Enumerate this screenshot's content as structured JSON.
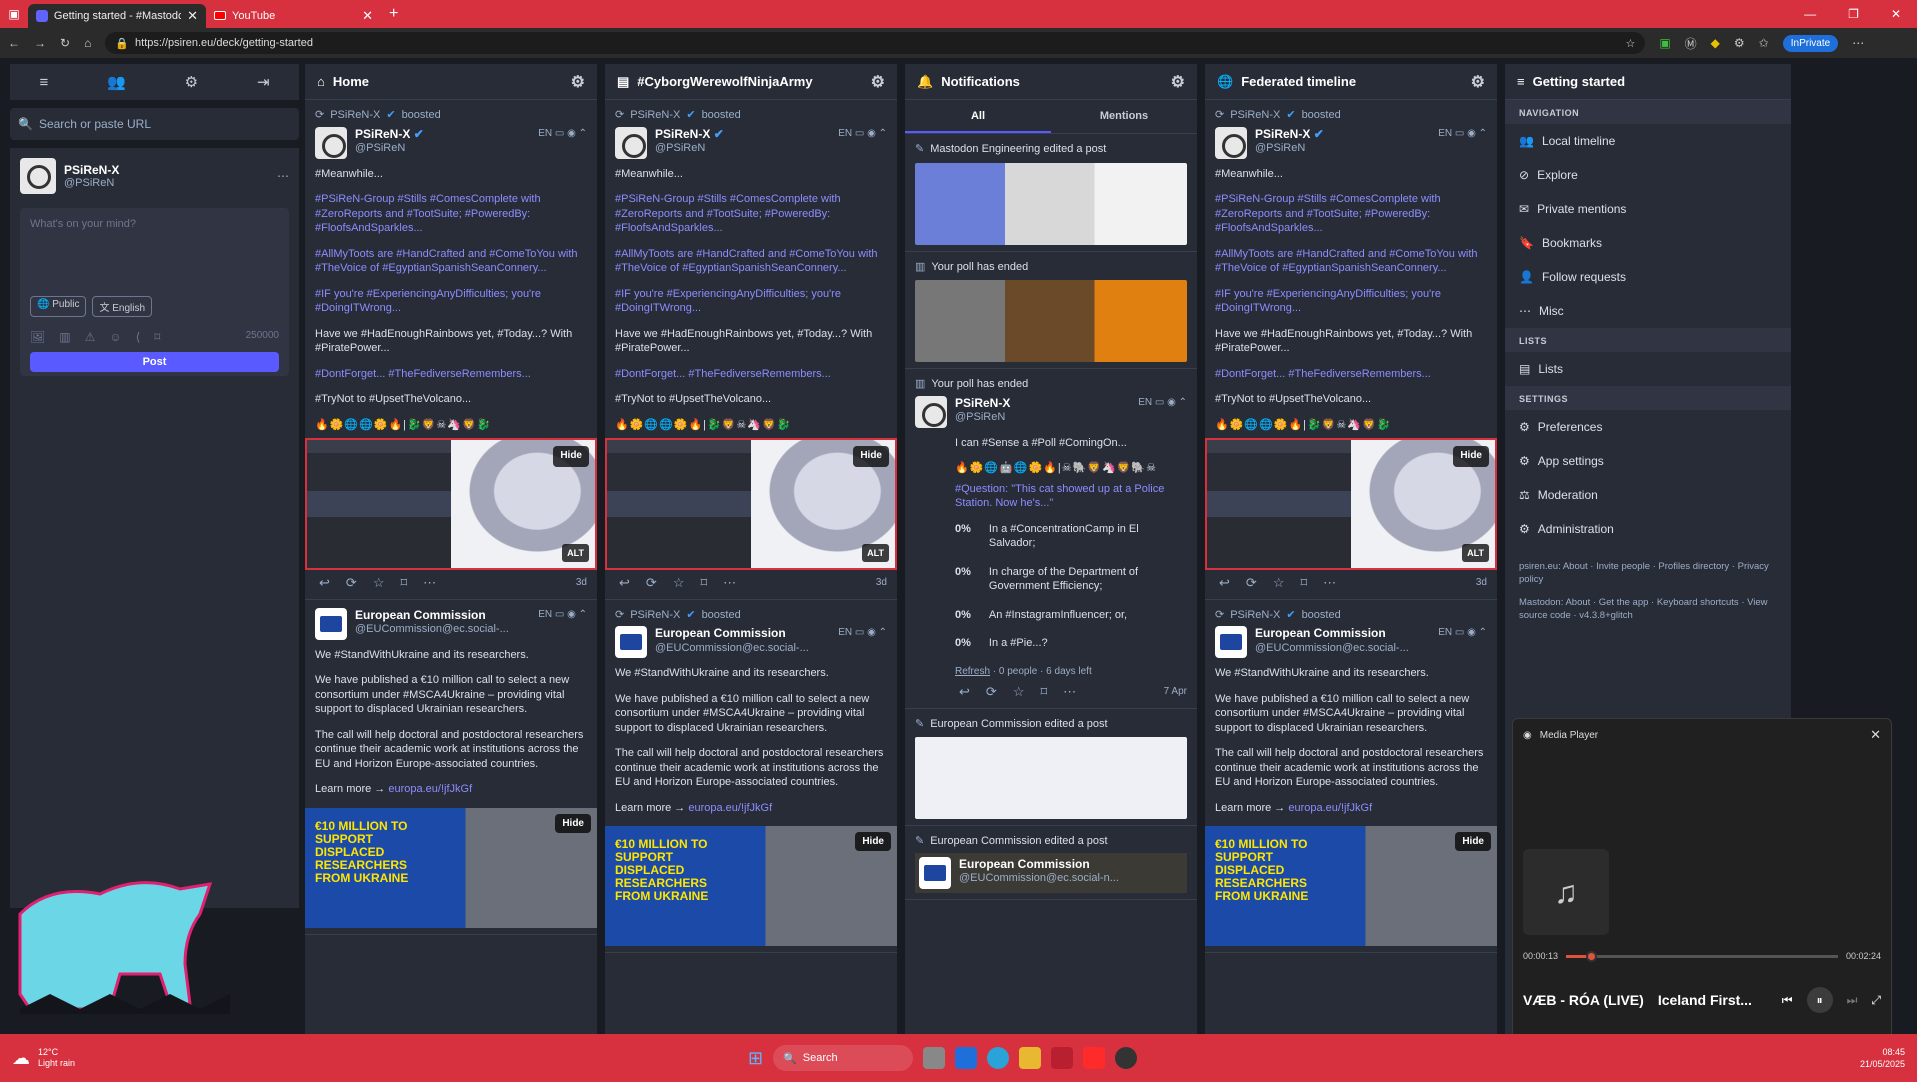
{
  "browser": {
    "tabs": [
      {
        "label": "Getting started - #MastodonSpyG",
        "active": true
      },
      {
        "label": "YouTube",
        "active": false
      }
    ],
    "url": "https://psiren.eu/deck/getting-started",
    "inprivate_label": "InPrivate"
  },
  "compose": {
    "search_placeholder": "Search or paste URL",
    "profile_name": "PSiReN-X",
    "profile_acct": "@PSiReN",
    "textarea_placeholder": "What's on your mind?",
    "visibility": "Public",
    "language": "English",
    "char_count": "250000",
    "post_label": "Post"
  },
  "columns": {
    "home": {
      "title": "Home"
    },
    "hashtag": {
      "title": "#CyborgWerewolfNinjaArmy"
    },
    "notifications": {
      "title": "Notifications",
      "tab_all": "All",
      "tab_mentions": "Mentions"
    },
    "federated": {
      "title": "Federated timeline"
    },
    "getting_started": {
      "title": "Getting started"
    }
  },
  "post1": {
    "prepend_name": "PSiReN-X",
    "prepend_action": "boosted",
    "name": "PSiReN-X",
    "acct": "@PSiReN",
    "lang": "EN",
    "para1": "#Meanwhile...",
    "para2": "#PSiReN-Group #Stills #ComesComplete with #ZeroReports and #TootSuite; #PoweredBy: #FloofsAndSparkles...",
    "para3": "#AllMyToots are #HandCrafted and #ComeToYou with #TheVoice of #EgyptianSpanishSeanConnery...",
    "para4": "#IF you're #ExperiencingAnyDifficulties; you're #DoingITWrong...",
    "para5": "Have we #HadEnoughRainbows yet, #Today...? With #PiratePower...",
    "para6": "#DontForget... #TheFediverseRemembers...",
    "para7": "#TryNot to #UpsetTheVolcano...",
    "emojis": "🔥🌼🌐🌐🌼🔥|🐉🦁☠🦄🦁🐉",
    "hide": "Hide",
    "alt": "ALT",
    "time": "3d"
  },
  "post2": {
    "name": "European Commission",
    "acct": "@EUCommission@ec.social-...",
    "lang": "EN",
    "para1": "We #StandWithUkraine and its researchers.",
    "para2": "We have published a €10 million call to select a new consortium under #MSCA4Ukraine – providing vital support to displaced Ukrainian researchers.",
    "para3": "The call will help doctoral and postdoctoral researchers continue their academic work at institutions across the EU and Horizon Europe-associated countries.",
    "learn_more": "Learn more →",
    "link": "europa.eu/!jfJkGf",
    "banner_text": "€10 MILLION TO SUPPORT DISPLACED RESEARCHERS FROM UKRAINE",
    "hide": "Hide"
  },
  "notifications": {
    "n1": "Mastodon Engineering edited a post",
    "n2": "Your poll has ended",
    "n3": "Your poll has ended",
    "poll_name": "PSiReN-X",
    "poll_acct": "@PSiReN",
    "poll_intro": "I can #Sense a #Poll #ComingOn...",
    "poll_emojis": "🔥🌼🌐🤖🌐🌼🔥|☠🐘🦁🦄🦁🐘☠",
    "poll_question": "#Question: \"This cat showed up at a Police Station. Now he's...\"",
    "options": [
      {
        "pct": "0%",
        "text": "In a #ConcentrationCamp in El Salvador;"
      },
      {
        "pct": "0%",
        "text": "In charge of the Department of Government Efficiency;"
      },
      {
        "pct": "0%",
        "text": "An #InstagramInfluencer; or,"
      },
      {
        "pct": "0%",
        "text": "In a #Pie...?"
      }
    ],
    "poll_footer_refresh": "Refresh",
    "poll_footer_rest": "· 0 people · 6 days left",
    "poll_time": "7 Apr",
    "n4": "European Commission edited a post",
    "n5": "European Commission edited a post",
    "n5_name": "European Commission",
    "n5_acct": "@EUCommission@ec.social-n..."
  },
  "getting_started": {
    "nav_heading": "NAVIGATION",
    "nav": [
      "Local timeline",
      "Explore",
      "Private mentions",
      "Bookmarks",
      "Follow requests",
      "Misc"
    ],
    "lists_heading": "LISTS",
    "lists": [
      "Lists"
    ],
    "settings_heading": "SETTINGS",
    "settings": [
      "Preferences",
      "App settings",
      "Moderation",
      "Administration"
    ],
    "footer1": "psiren.eu: About · Invite people · Profiles directory · Privacy policy",
    "footer2": "Mastodon: About · Get the app · Keyboard shortcuts · View source code · v4.3.8+glitch"
  },
  "media_player": {
    "title": "Media Player",
    "elapsed": "00:00:13",
    "duration": "00:02:24",
    "progress": 0.09,
    "track": "VÆB - RÓA (LIVE)",
    "album": "Iceland First..."
  },
  "taskbar": {
    "weather_temp": "12°C",
    "weather_desc": "Light rain",
    "search": "Search",
    "time": "08:45",
    "date": "21/05/2025"
  },
  "colors": {
    "accent": "#d7303f",
    "mastodon_bg": "#282c37",
    "link": "#8c8dff",
    "post_button": "#595aff"
  }
}
